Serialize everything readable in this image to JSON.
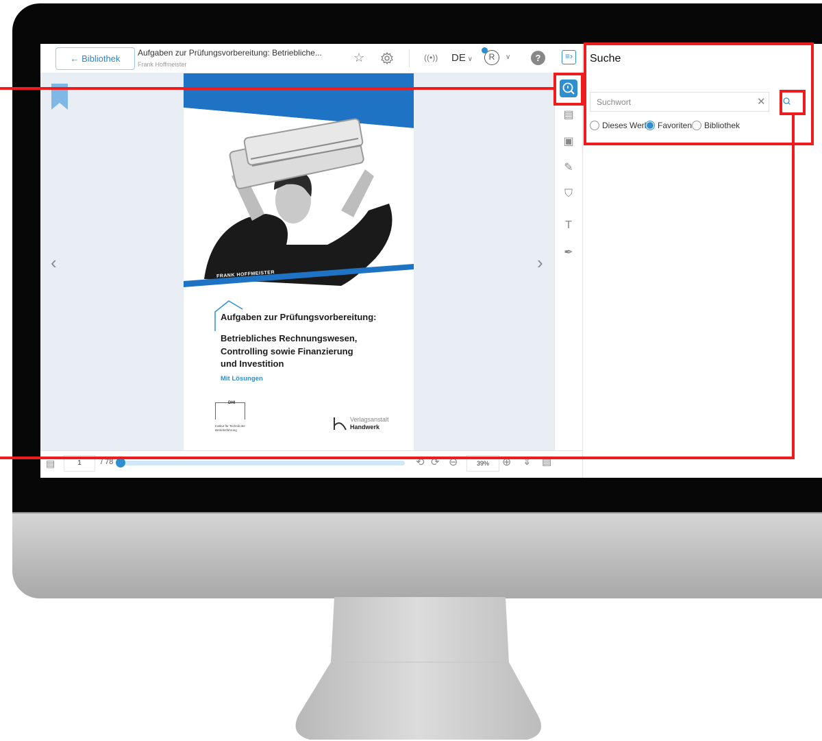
{
  "app": {
    "back_label": "← Bibliothek",
    "book_title": "Aufgaben zur Prüfungsvorbereitung: Betriebliche...",
    "book_author": "Frank Hoffmeister",
    "language": "DE",
    "help_label": "?"
  },
  "cover": {
    "author_banner": "FRANK HOFFMEISTER",
    "title": "Aufgaben zur Prüfungsvorbereitung:",
    "subtitle": "Betriebliches Rechnungswesen,\nControlling sowie Finanzierung\nund Investition",
    "solutions": "Mit Lösungen",
    "logo_left": "DHI",
    "logo_left_caption": "Institut für Technik der Betriebsführung",
    "publisher_line1": "Verlagsanstalt",
    "publisher_line2": "Handwerk"
  },
  "search_panel": {
    "title": "Suche",
    "placeholder": "Suchwort",
    "scope_options": [
      "Dieses Werk",
      "Favoriten",
      "Bibliothek"
    ],
    "selected_scope": "Favoriten"
  },
  "footer": {
    "page_number": "1",
    "page_total": "/ 78",
    "zoom": "39%",
    "progress": 0.0
  },
  "colors": {
    "accent": "#2f8fce",
    "annotation": "#ee1c1c",
    "bookmark": "#7fb7e6"
  },
  "icons": [
    "search-icon",
    "toc-icon",
    "pages-icon",
    "notes-icon",
    "bookmark-icon",
    "text-select-icon",
    "pen-icon",
    "star-icon",
    "gear-icon",
    "broadcast-icon",
    "user-icon",
    "help-icon",
    "panel-toggle-icon"
  ]
}
